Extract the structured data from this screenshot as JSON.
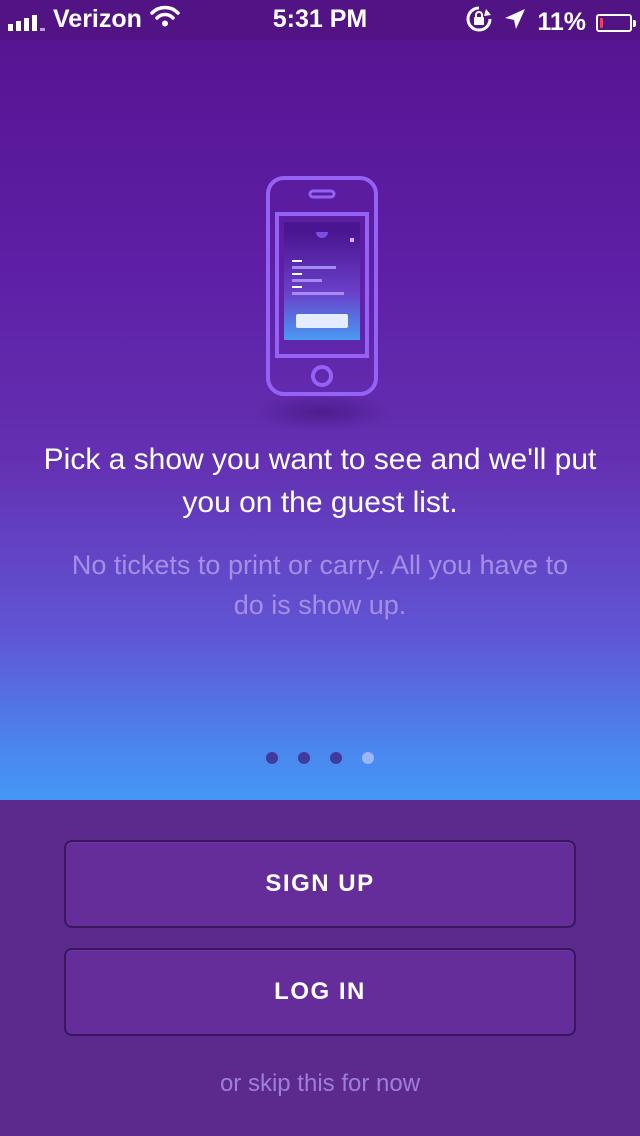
{
  "status_bar": {
    "carrier": "Verizon",
    "time": "5:31 PM",
    "battery_percent": "11%",
    "battery_level": 0.11,
    "icons": [
      "signal-icon",
      "wifi-icon",
      "rotation-lock-icon",
      "location-icon",
      "battery-icon"
    ]
  },
  "onboarding": {
    "headline": "Pick a show you want to see and we'll put you on the guest list.",
    "subtext": "No tickets to print or carry. All you have to do is show up.",
    "page_count": 4,
    "current_page": 4
  },
  "actions": {
    "signup_label": "SIGN UP",
    "login_label": "LOG IN",
    "skip_label": "or skip this for now"
  },
  "colors": {
    "status_bar": "#521385",
    "hero_top": "#561592",
    "hero_bottom": "#4697f5",
    "bottom_panel": "#5c2a8c",
    "button_fill": "#652d99",
    "button_border": "#3a1660",
    "subtext": "#a68ee6",
    "illustration": "#9462f5"
  }
}
